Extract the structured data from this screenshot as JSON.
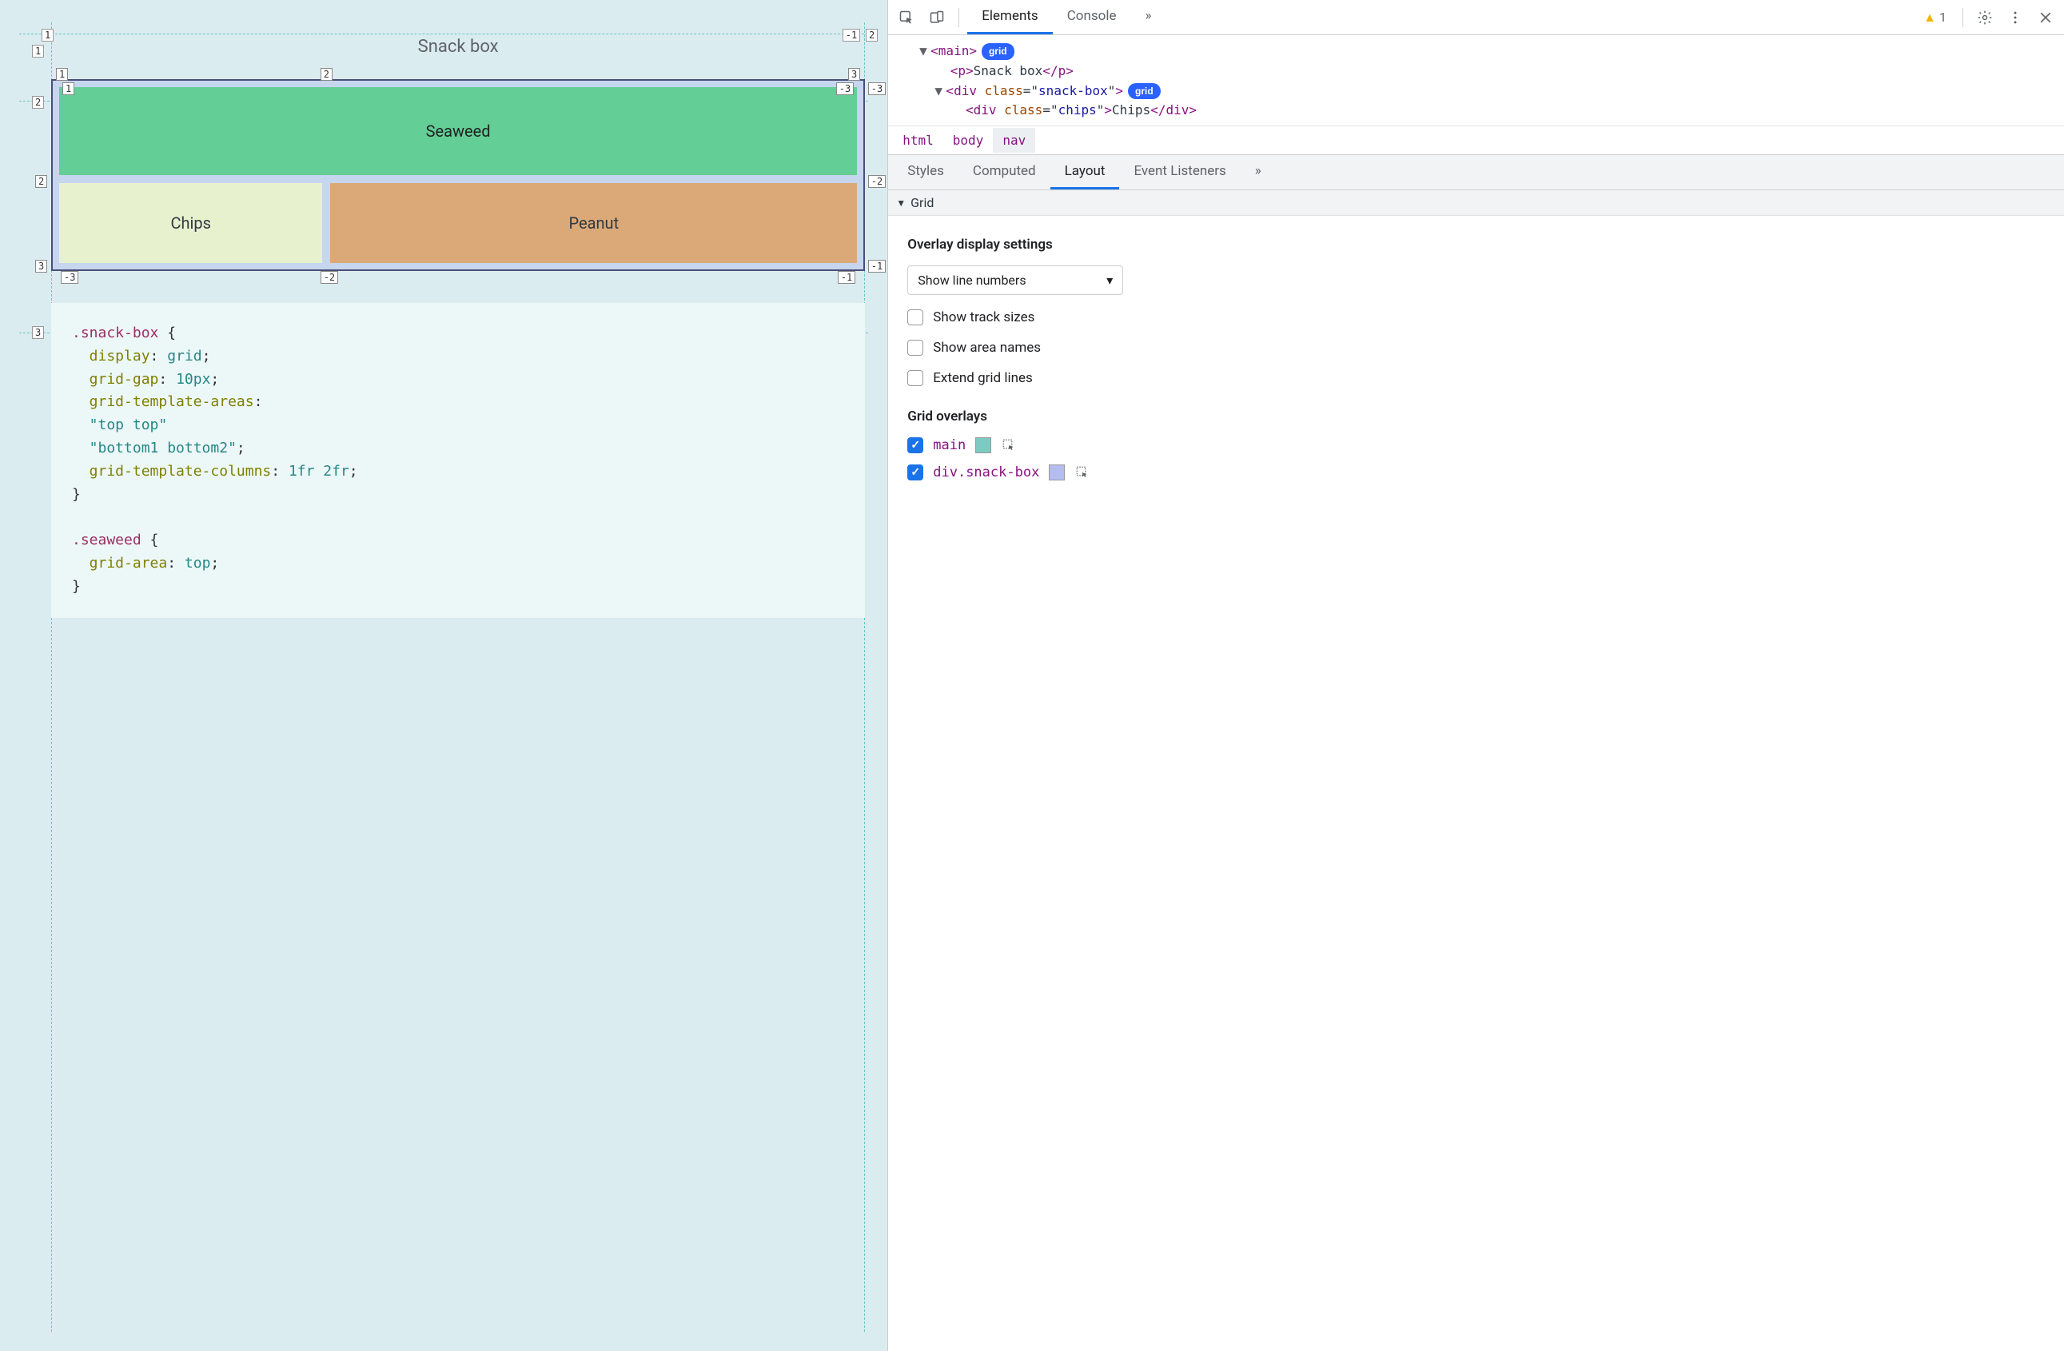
{
  "preview": {
    "title": "Snack box",
    "cells": {
      "seaweed": "Seaweed",
      "chips": "Chips",
      "peanut": "Peanut"
    },
    "outer_grid_labels": {
      "top_left": "1",
      "top_right": "-1",
      "row1_left": "1",
      "row2_left": "2",
      "row3_left": "3",
      "col_extra_right": "2"
    },
    "inner_grid_labels": {
      "top": [
        "1",
        "2",
        "3"
      ],
      "top_neg": "-3",
      "left": [
        "1",
        "2",
        "3"
      ],
      "left_neg": [
        "-3"
      ],
      "right": [
        "-1",
        "-2",
        "-3"
      ],
      "right_pos_top": "-3",
      "bottom": [
        "-3",
        "-2",
        "-1"
      ]
    },
    "code_lines": [
      {
        "t": "sel",
        "s": ".snack-box"
      },
      {
        "t": "brace",
        "s": " {"
      },
      {
        "t": "nl"
      },
      {
        "t": "prop",
        "s": "  display"
      },
      {
        "t": "plain",
        "s": ": "
      },
      {
        "t": "val",
        "s": "grid"
      },
      {
        "t": "plain",
        "s": ";"
      },
      {
        "t": "nl"
      },
      {
        "t": "prop",
        "s": "  grid-gap"
      },
      {
        "t": "plain",
        "s": ": "
      },
      {
        "t": "val",
        "s": "10px"
      },
      {
        "t": "plain",
        "s": ";"
      },
      {
        "t": "nl"
      },
      {
        "t": "prop",
        "s": "  grid-template-areas"
      },
      {
        "t": "plain",
        "s": ":"
      },
      {
        "t": "nl"
      },
      {
        "t": "str",
        "s": "  \"top top\""
      },
      {
        "t": "nl"
      },
      {
        "t": "str",
        "s": "  \"bottom1 bottom2\""
      },
      {
        "t": "plain",
        "s": ";"
      },
      {
        "t": "nl"
      },
      {
        "t": "prop",
        "s": "  grid-template-columns"
      },
      {
        "t": "plain",
        "s": ": "
      },
      {
        "t": "val",
        "s": "1fr 2fr"
      },
      {
        "t": "plain",
        "s": ";"
      },
      {
        "t": "nl"
      },
      {
        "t": "plain",
        "s": "}"
      },
      {
        "t": "nl"
      },
      {
        "t": "nl"
      },
      {
        "t": "sel",
        "s": ".seaweed"
      },
      {
        "t": "brace",
        "s": " {"
      },
      {
        "t": "nl"
      },
      {
        "t": "prop",
        "s": "  grid-area"
      },
      {
        "t": "plain",
        "s": ": "
      },
      {
        "t": "val",
        "s": "top"
      },
      {
        "t": "plain",
        "s": ";"
      },
      {
        "t": "nl"
      },
      {
        "t": "plain",
        "s": "}"
      }
    ]
  },
  "devtools": {
    "tabs": {
      "elements": "Elements",
      "console": "Console",
      "more": "»"
    },
    "warning_count": "1",
    "dom": {
      "line1": {
        "open": "▼",
        "tag": "main",
        "badge": "grid"
      },
      "line2": {
        "tag": "p",
        "text": "Snack box"
      },
      "line3": {
        "open": "▼",
        "tag": "div",
        "attr_name": "class",
        "attr_val": "snack-box",
        "badge": "grid"
      },
      "line4": {
        "tag": "div",
        "attr_name": "class",
        "attr_val": "chips",
        "text": "Chips"
      }
    },
    "breadcrumbs": [
      "html",
      "body",
      "nav"
    ],
    "subtabs": [
      "Styles",
      "Computed",
      "Layout",
      "Event Listeners",
      "»"
    ],
    "layout": {
      "section_title": "Grid",
      "overlay_settings_title": "Overlay display settings",
      "dropdown_label": "Show line numbers",
      "checks": [
        {
          "label": "Show track sizes",
          "checked": false
        },
        {
          "label": "Show area names",
          "checked": false
        },
        {
          "label": "Extend grid lines",
          "checked": false
        }
      ],
      "grid_overlays_title": "Grid overlays",
      "overlays": [
        {
          "label": "main",
          "checked": true,
          "swatch": "teal"
        },
        {
          "label": "div.snack-box",
          "checked": true,
          "swatch": "lilac"
        }
      ]
    }
  }
}
